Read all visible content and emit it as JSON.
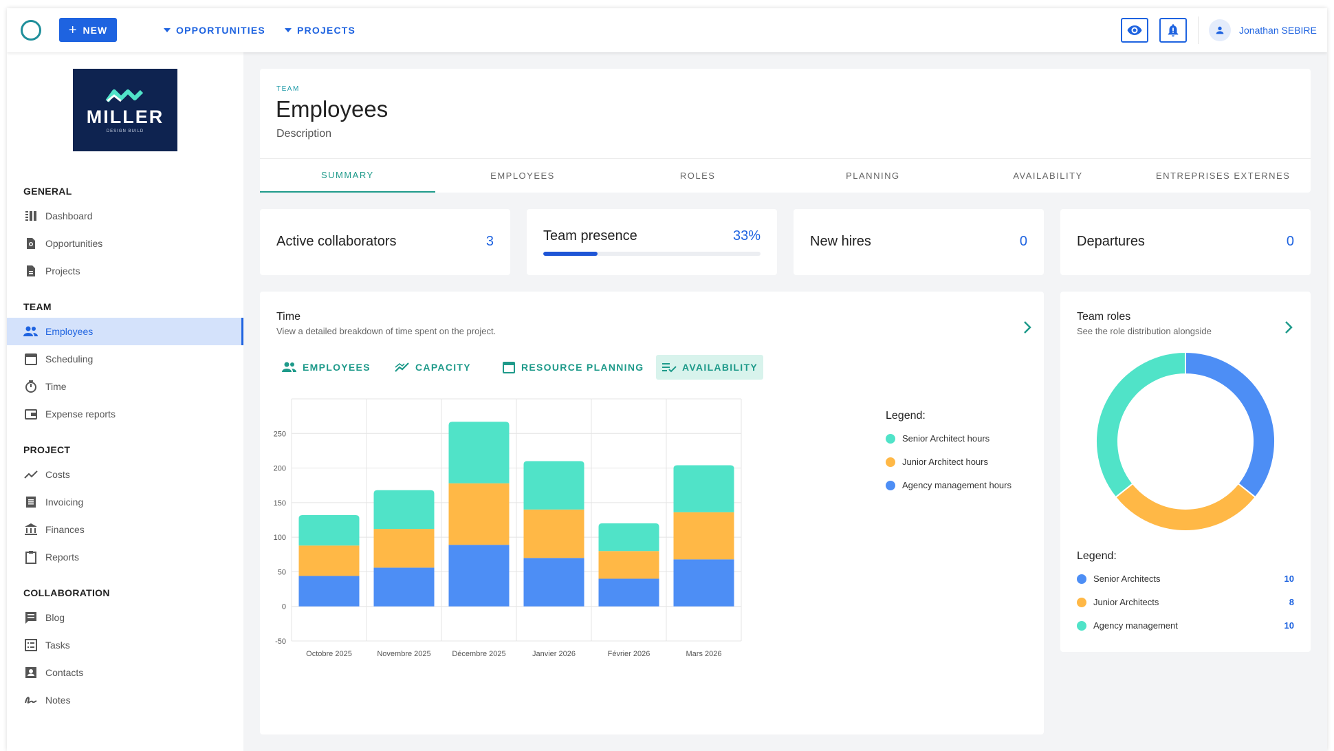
{
  "topbar": {
    "new_label": "NEW",
    "nav": [
      "OPPORTUNITIES",
      "PROJECTS"
    ],
    "user_name": "Jonathan SEBIRE"
  },
  "sidebar": {
    "brand_name": "MILLER",
    "brand_sub": "DESIGN BUILD",
    "sections": [
      {
        "title": "GENERAL",
        "items": [
          "Dashboard",
          "Opportunities",
          "Projects"
        ]
      },
      {
        "title": "TEAM",
        "items": [
          "Employees",
          "Scheduling",
          "Time",
          "Expense reports"
        ]
      },
      {
        "title": "PROJECT",
        "items": [
          "Costs",
          "Invoicing",
          "Finances",
          "Reports"
        ]
      },
      {
        "title": "COLLABORATION",
        "items": [
          "Blog",
          "Tasks",
          "Contacts",
          "Notes"
        ]
      }
    ],
    "active_item": "Employees"
  },
  "header": {
    "crumb": "TEAM",
    "title": "Employees",
    "description": "Description",
    "tabs": [
      "SUMMARY",
      "EMPLOYEES",
      "ROLES",
      "PLANNING",
      "AVAILABILITY",
      "ENTREPRISES EXTERNES"
    ],
    "active_tab": "SUMMARY"
  },
  "stats": [
    {
      "label": "Active collaborators",
      "value": "3"
    },
    {
      "label": "Team presence",
      "value": "33%",
      "progress": 0.25
    },
    {
      "label": "New hires",
      "value": "0"
    },
    {
      "label": "Departures",
      "value": "0"
    }
  ],
  "time_card": {
    "title": "Time",
    "subtitle": "View a detailed breakdown of time spent on the project.",
    "chips": [
      "EMPLOYEES",
      "CAPACITY",
      "RESOURCE PLANNING",
      "AVAILABILITY"
    ],
    "active_chip": "AVAILABILITY",
    "legend_title": "Legend:"
  },
  "roles_card": {
    "title": "Team roles",
    "subtitle": "See the role distribution alongside",
    "legend_title": "Legend:"
  },
  "colors": {
    "accent": "#1e63e0",
    "teal": "#1e9a8a",
    "senior": "#4d8ef5",
    "junior": "#ffb846",
    "agency": "#50e3c8"
  },
  "chart_data": [
    {
      "type": "bar",
      "stacked": true,
      "categories": [
        "Octobre 2025",
        "Novembre 2025",
        "Décembre 2025",
        "Janvier 2026",
        "Février 2026",
        "Mars 2026"
      ],
      "series": [
        {
          "name": "Agency management hours",
          "color": "#4d8ef5",
          "values": [
            44,
            56,
            89,
            70,
            40,
            68
          ]
        },
        {
          "name": "Junior Architect hours",
          "color": "#ffb846",
          "values": [
            44,
            56,
            89,
            70,
            40,
            68
          ]
        },
        {
          "name": "Senior Architect hours",
          "color": "#50e3c8",
          "values": [
            44,
            56,
            89,
            70,
            40,
            68
          ]
        }
      ],
      "legend_order": [
        "Senior Architect hours",
        "Junior Architect hours",
        "Agency management hours"
      ],
      "yticks": [
        -50,
        0,
        50,
        100,
        150,
        200,
        250
      ],
      "ylim": [
        -50,
        300
      ],
      "grid": true,
      "legend_position": "right"
    },
    {
      "type": "pie",
      "donut": true,
      "labels": [
        "Senior Architects",
        "Junior Architects",
        "Agency management"
      ],
      "values": [
        10,
        8,
        10
      ],
      "colors": [
        "#4d8ef5",
        "#ffb846",
        "#50e3c8"
      ],
      "legend_position": "bottom"
    }
  ]
}
